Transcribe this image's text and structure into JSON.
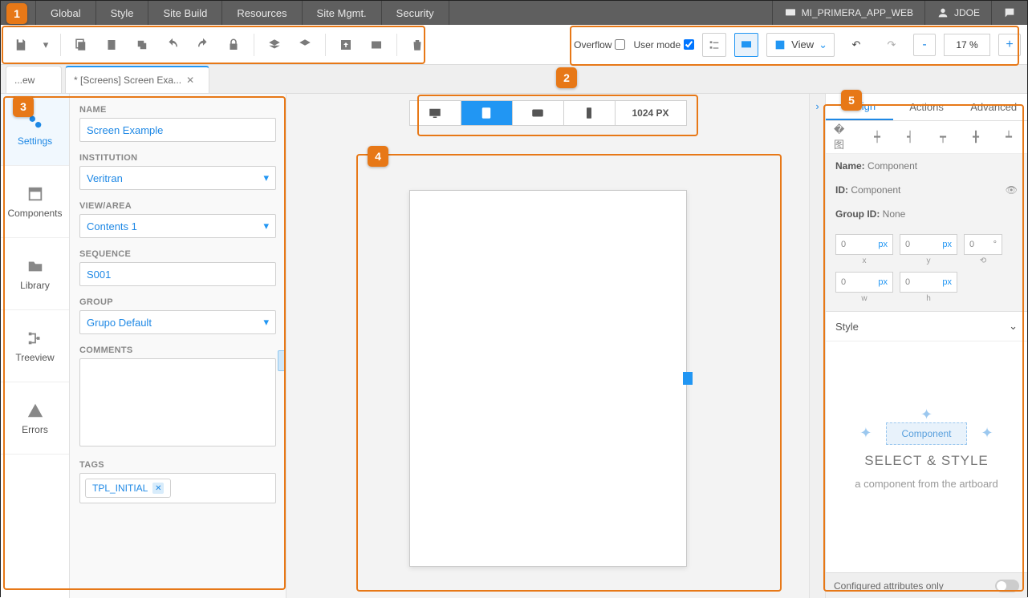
{
  "top_menu": {
    "items": [
      "Global",
      "Style",
      "Site Build",
      "Resources",
      "Site Mgmt.",
      "Security"
    ],
    "app_name": "MI_PRIMERA_APP_WEB",
    "user": "JDOE"
  },
  "toolbar": {
    "overflow_label": "Overflow",
    "user_mode_label": "User mode",
    "view_label": "View",
    "zoom": "17 %"
  },
  "tabs": {
    "primary": "...ew",
    "secondary": "* [Screens] Screen Exa..."
  },
  "sidebar": {
    "items": [
      "Settings",
      "Components",
      "Library",
      "Treeview",
      "Errors"
    ]
  },
  "settings": {
    "name_label": "NAME",
    "name_value": "Screen Example",
    "institution_label": "INSTITUTION",
    "institution_value": "Veritran",
    "view_label": "VIEW/AREA",
    "view_value": "Contents 1",
    "sequence_label": "SEQUENCE",
    "sequence_value": "S001",
    "group_label": "GROUP",
    "group_value": "Grupo Default",
    "comments_label": "COMMENTS",
    "tags_label": "TAGS",
    "tag_value": "TPL_INITIAL"
  },
  "device_bar": {
    "size": "1024 PX"
  },
  "right_panel": {
    "tabs": [
      "Design",
      "Actions",
      "Advanced"
    ],
    "name_label": "Name:",
    "name_value": "Component",
    "id_label": "ID:",
    "id_value": "Component",
    "group_label": "Group ID:",
    "group_value": "None",
    "coord_x": "0",
    "coord_x_unit": "px",
    "coord_y": "0",
    "coord_y_unit": "px",
    "coord_rot": "0",
    "coord_w": "0",
    "coord_w_unit": "px",
    "coord_h": "0",
    "coord_h_unit": "px",
    "style_label": "Style",
    "comp_chip": "Component",
    "placeholder_title": "SELECT & STYLE",
    "placeholder_sub": "a component from the artboard",
    "footer_label": "Configured attributes only"
  },
  "annotations": [
    "1",
    "2",
    "3",
    "4",
    "5"
  ]
}
